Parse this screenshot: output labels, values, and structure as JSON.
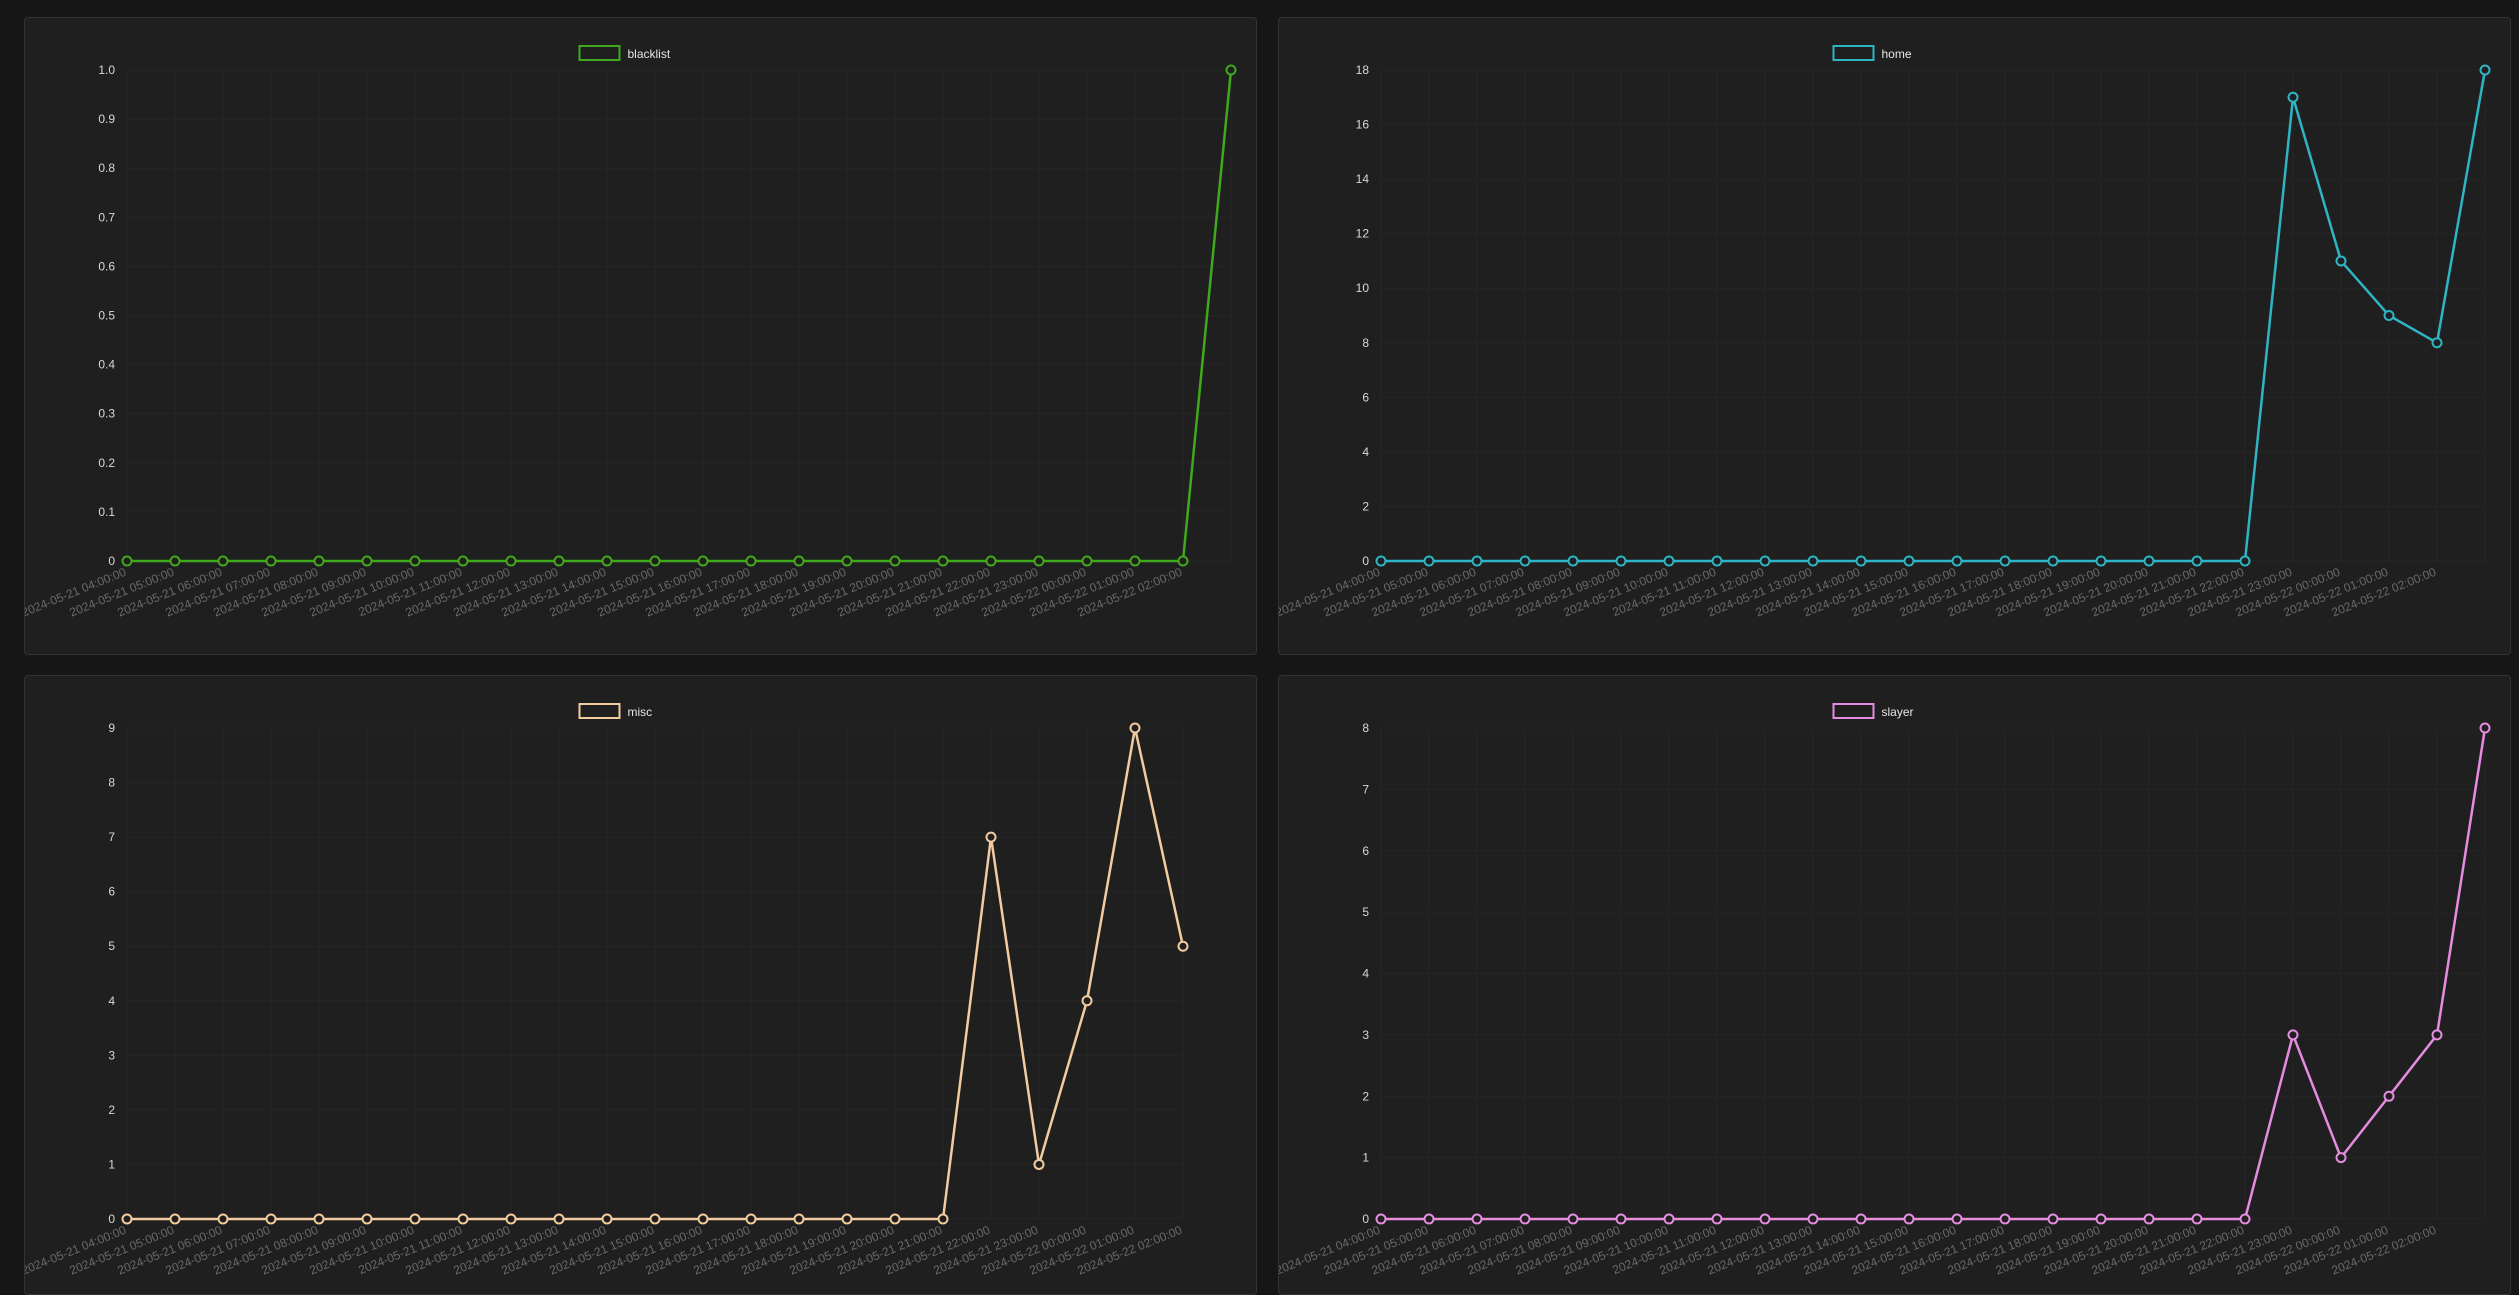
{
  "x_labels": [
    "2024-05-21 04:00:00",
    "2024-05-21 05:00:00",
    "2024-05-21 06:00:00",
    "2024-05-21 07:00:00",
    "2024-05-21 08:00:00",
    "2024-05-21 09:00:00",
    "2024-05-21 10:00:00",
    "2024-05-21 11:00:00",
    "2024-05-21 12:00:00",
    "2024-05-21 13:00:00",
    "2024-05-21 14:00:00",
    "2024-05-21 15:00:00",
    "2024-05-21 16:00:00",
    "2024-05-21 17:00:00",
    "2024-05-21 18:00:00",
    "2024-05-21 19:00:00",
    "2024-05-21 20:00:00",
    "2024-05-21 21:00:00",
    "2024-05-21 22:00:00",
    "2024-05-21 23:00:00",
    "2024-05-22 00:00:00",
    "2024-05-22 01:00:00",
    "2024-05-22 02:00:00"
  ],
  "chart_data": [
    {
      "type": "line",
      "series": [
        {
          "name": "blacklist",
          "color": "#3fa81c",
          "values": [
            0,
            0,
            0,
            0,
            0,
            0,
            0,
            0,
            0,
            0,
            0,
            0,
            0,
            0,
            0,
            0,
            0,
            0,
            0,
            0,
            0,
            0,
            0,
            1
          ]
        }
      ],
      "ylim": [
        0,
        1
      ],
      "y_ticks": [
        "0",
        "0.1",
        "0.2",
        "0.3",
        "0.4",
        "0.5",
        "0.6",
        "0.7",
        "0.8",
        "0.9",
        "1.0"
      ],
      "legend": "top-center",
      "grid": true
    },
    {
      "type": "line",
      "series": [
        {
          "name": "home",
          "color": "#2fb4c4",
          "values": [
            0,
            0,
            0,
            0,
            0,
            0,
            0,
            0,
            0,
            0,
            0,
            0,
            0,
            0,
            0,
            0,
            0,
            0,
            0,
            17,
            11,
            9,
            8,
            18
          ]
        }
      ],
      "ylim": [
        0,
        18
      ],
      "y_ticks": [
        "0",
        "2",
        "4",
        "6",
        "8",
        "10",
        "12",
        "14",
        "16",
        "18"
      ],
      "legend": "top-center",
      "grid": true
    },
    {
      "type": "line",
      "series": [
        {
          "name": "misc",
          "color": "#f2cba0",
          "values": [
            0,
            0,
            0,
            0,
            0,
            0,
            0,
            0,
            0,
            0,
            0,
            0,
            0,
            0,
            0,
            0,
            0,
            0,
            7,
            1,
            4,
            9,
            5
          ]
        }
      ],
      "ylim": [
        0,
        9
      ],
      "y_ticks": [
        "0",
        "1",
        "2",
        "3",
        "4",
        "5",
        "6",
        "7",
        "8",
        "9"
      ],
      "legend": "top-center",
      "grid": true
    },
    {
      "type": "line",
      "series": [
        {
          "name": "slayer",
          "color": "#e58ce0",
          "values": [
            0,
            0,
            0,
            0,
            0,
            0,
            0,
            0,
            0,
            0,
            0,
            0,
            0,
            0,
            0,
            0,
            0,
            0,
            0,
            3,
            1,
            2,
            3,
            8
          ]
        }
      ],
      "ylim": [
        0,
        8
      ],
      "y_ticks": [
        "0",
        "1",
        "2",
        "3",
        "4",
        "5",
        "6",
        "7",
        "8"
      ],
      "legend": "top-center",
      "grid": true
    }
  ]
}
